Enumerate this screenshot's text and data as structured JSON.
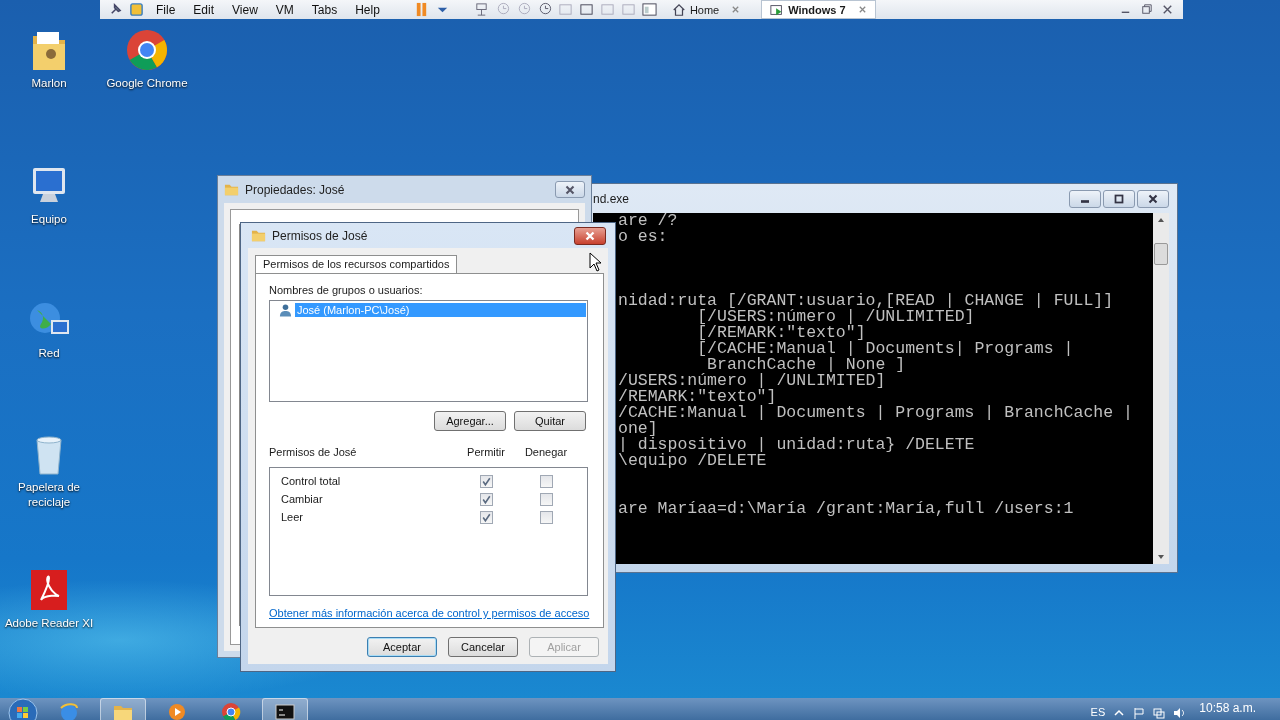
{
  "vm_toolbar": {
    "menus": [
      "File",
      "Edit",
      "View",
      "VM",
      "Tabs",
      "Help"
    ],
    "tabs": [
      {
        "label": "Home",
        "kind": "home",
        "selected": false
      },
      {
        "label": "Windows 7",
        "kind": "vm",
        "selected": true
      }
    ]
  },
  "desktop_icons": [
    {
      "label": "Marlon",
      "kind": "folder"
    },
    {
      "label": "Google Chrome",
      "kind": "chrome"
    },
    {
      "label": "Equipo",
      "kind": "computer"
    },
    {
      "label": "Red",
      "kind": "network"
    },
    {
      "label": "Papelera de reciclaje",
      "kind": "recycle"
    },
    {
      "label": "Adobe Reader XI",
      "kind": "pdf"
    }
  ],
  "console_window": {
    "title": "nd.exe",
    "lines": [
      {
        "kind": "text",
        "text": "are /?"
      },
      {
        "kind": "text",
        "text": "o es:"
      },
      {
        "kind": "blank"
      },
      {
        "kind": "blank"
      },
      {
        "kind": "blank"
      },
      {
        "kind": "text",
        "text": "nidad:ruta [/GRANT:usuario,[READ | CHANGE | FULL]]"
      },
      {
        "kind": "text",
        "text": "        [/USERS:número | /UNLIMITED]"
      },
      {
        "kind": "text",
        "text": "        [/REMARK:\"texto\"]"
      },
      {
        "kind": "text",
        "text": "        [/CACHE:Manual | Documents| Programs |"
      },
      {
        "kind": "text",
        "text": "         BranchCache | None ]"
      },
      {
        "kind": "text",
        "text": "/USERS:número | /UNLIMITED]"
      },
      {
        "kind": "text",
        "text": "/REMARK:\"texto\"]"
      },
      {
        "kind": "text",
        "text": "/CACHE:Manual | Documents | Programs | BranchCache |"
      },
      {
        "kind": "text",
        "text": "one]"
      },
      {
        "kind": "text",
        "text": "| dispositivo | unidad:ruta} /DELETE"
      },
      {
        "kind": "text",
        "text": "\\equipo /DELETE"
      },
      {
        "kind": "blank"
      },
      {
        "kind": "blank"
      },
      {
        "kind": "text",
        "text": "are Maríaa=d:\\María /grant:María,full /users:1"
      }
    ]
  },
  "properties_window": {
    "title": "Propiedades: José"
  },
  "permissions_dialog": {
    "title": "Permisos de José",
    "tabs": [
      {
        "label": "Permisos de los recursos compartidos",
        "selected": true
      }
    ],
    "users_label": "Nombres de grupos o usuarios:",
    "users": [
      {
        "name": "José (Marlon-PC\\José)",
        "selected": true
      }
    ],
    "user_buttons": [
      "Agregar...",
      "Quitar"
    ],
    "permissions_label": "Permisos de José",
    "columns": [
      "Permitir",
      "Denegar"
    ],
    "permissions": [
      {
        "name": "Control total",
        "allow": true,
        "deny": false
      },
      {
        "name": "Cambiar",
        "allow": true,
        "deny": false
      },
      {
        "name": "Leer",
        "allow": true,
        "deny": false
      }
    ],
    "link": "Obtener más información acerca de control y permisos de acceso",
    "buttons": [
      {
        "label": "Aceptar",
        "default": true,
        "disabled": false
      },
      {
        "label": "Cancelar",
        "default": false,
        "disabled": false
      },
      {
        "label": "Aplicar",
        "default": false,
        "disabled": true
      }
    ]
  },
  "taskbar": {
    "apps": [
      {
        "kind": "ie",
        "active": false
      },
      {
        "kind": "explorer",
        "active": true
      },
      {
        "kind": "media",
        "active": false
      },
      {
        "kind": "chrome",
        "active": false
      },
      {
        "kind": "cmd",
        "active": true
      }
    ],
    "language": "ES",
    "clock": "10:58 a.m."
  }
}
